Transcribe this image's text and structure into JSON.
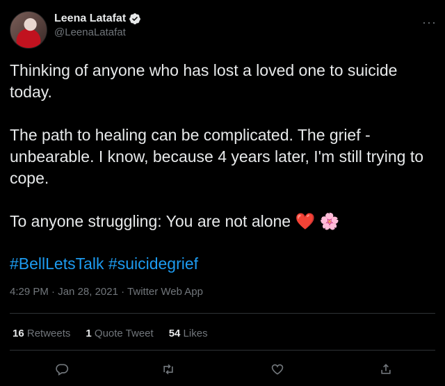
{
  "author": {
    "display_name": "Leena Latafat",
    "handle": "@LeenaLatafat",
    "verified": true
  },
  "tweet": {
    "text": "Thinking of anyone who has lost a loved one to suicide today.\n\nThe path to healing can be complicated. The grief - unbearable. I know, because 4 years later, I'm still trying to cope.\n\nTo anyone struggling: You are not alone ❤️ 🌸",
    "hashtags": [
      "#BellLetsTalk",
      "#suicidegrief"
    ],
    "time": "4:29 PM",
    "date": "Jan 28, 2021",
    "source": "Twitter Web App"
  },
  "stats": {
    "retweets_count": "16",
    "retweets_label": "Retweets",
    "quotes_count": "1",
    "quotes_label": "Quote Tweet",
    "likes_count": "54",
    "likes_label": "Likes"
  },
  "more_label": "···",
  "colors": {
    "accent": "#1d9bf0",
    "muted": "#71767b",
    "text": "#e7e9ea",
    "background": "#000000"
  }
}
